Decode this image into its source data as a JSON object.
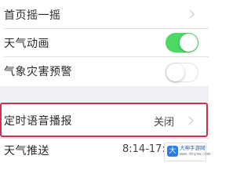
{
  "settings": {
    "home_shake": {
      "label": "首页摇一摇"
    },
    "weather_animation": {
      "label": "天气动画",
      "toggle": "on"
    },
    "disaster_warning": {
      "label": "气象灾害预警",
      "toggle": "off"
    },
    "timed_voice": {
      "label": "定时语音播报",
      "value": "关闭"
    },
    "weather_push": {
      "label": "天气推送",
      "value": "8:14-17:"
    }
  },
  "colors": {
    "toggle_on": "#4cd964",
    "highlight_border": "#c8334f",
    "group_gap": "#efeff4"
  },
  "watermark": {
    "logo_char": "大",
    "title": "大神手游网",
    "subtitle": "www.dsyxw.com"
  }
}
